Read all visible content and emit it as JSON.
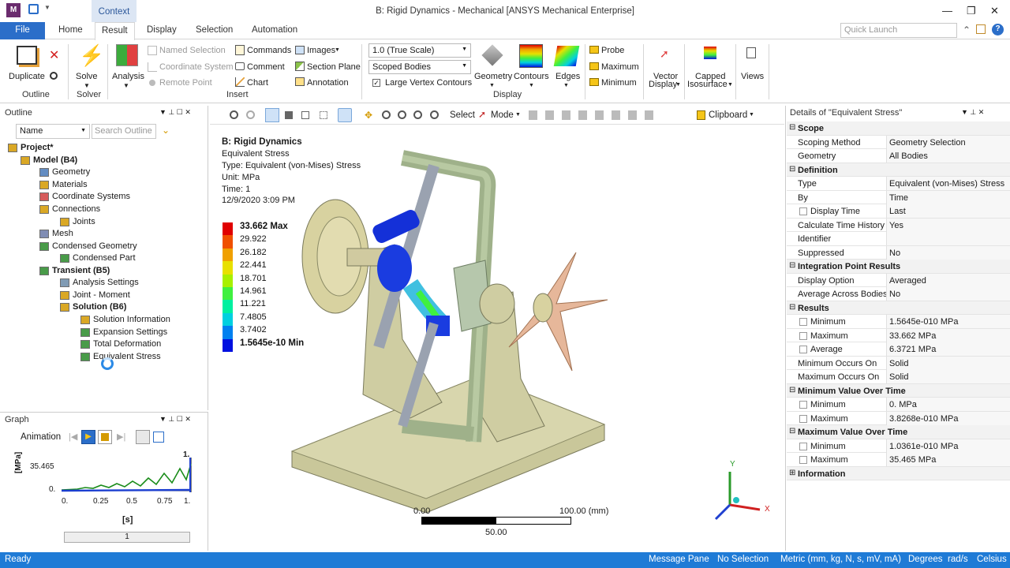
{
  "window": {
    "title": "B: Rigid Dynamics - Mechanical [ANSYS Mechanical Enterprise]",
    "context_tab": "Context"
  },
  "tabs": {
    "file": "File",
    "items": [
      "Home",
      "Result",
      "Display",
      "Selection",
      "Automation"
    ],
    "active": "Result"
  },
  "quick_launch": {
    "placeholder": "Quick Launch"
  },
  "ribbon": {
    "outline": {
      "duplicate": "Duplicate",
      "group": "Outline"
    },
    "solve": {
      "solve": "Solve",
      "group": "Solver"
    },
    "insert": {
      "analysis": "Analysis",
      "named_selection": "Named Selection",
      "coordinate_system": "Coordinate System",
      "remote_point": "Remote Point",
      "commands": "Commands",
      "comment": "Comment",
      "chart": "Chart",
      "images": "Images",
      "section_plane": "Section Plane",
      "annotation": "Annotation",
      "group": "Insert"
    },
    "display": {
      "scale": "1.0 (True Scale)",
      "bodies": "Scoped Bodies",
      "large_vertex": "Large Vertex Contours",
      "geometry": "Geometry",
      "contours": "Contours",
      "edges": "Edges",
      "group": "Display"
    },
    "probe": {
      "probe": "Probe",
      "maximum": "Maximum",
      "minimum": "Minimum"
    },
    "vector": {
      "line1": "Vector",
      "line2": "Display"
    },
    "capped": {
      "line1": "Capped",
      "line2": "Isosurface"
    },
    "views": "Views"
  },
  "outline": {
    "title": "Outline",
    "filter": "Name",
    "search_placeholder": "Search Outline",
    "tree": {
      "project": "Project*",
      "model": "Model (B4)",
      "geometry": "Geometry",
      "materials": "Materials",
      "coord": "Coordinate Systems",
      "connections": "Connections",
      "joints": "Joints",
      "mesh": "Mesh",
      "condensed": "Condensed Geometry",
      "condensed_part": "Condensed Part",
      "transient": "Transient (B5)",
      "analysis_settings": "Analysis Settings",
      "joint_moment": "Joint - Moment",
      "solution": "Solution (B6)",
      "solution_info": "Solution Information",
      "expansion": "Expansion Settings",
      "total_def": "Total Deformation",
      "eq_stress": "Equivalent Stress"
    }
  },
  "graph": {
    "title": "Graph",
    "animation": "Animation",
    "ymax": "35.465",
    "ymin": "0.",
    "ylabel": "[MPa]",
    "xlabel": "[s]",
    "xticks": [
      "0.",
      "0.25",
      "0.5",
      "0.75",
      "1."
    ],
    "corner": "1.",
    "frame": "1"
  },
  "toolbar": {
    "select": "Select",
    "mode": "Mode",
    "clipboard": "Clipboard"
  },
  "viewport": {
    "header": {
      "title": "B: Rigid Dynamics",
      "result": "Equivalent Stress",
      "type": "Type: Equivalent (von-Mises) Stress",
      "unit": "Unit: MPa",
      "time": "Time: 1",
      "date": "12/9/2020 3:09 PM"
    },
    "legend": [
      "33.662 Max",
      "29.922",
      "26.182",
      "22.441",
      "18.701",
      "14.961",
      "11.221",
      "7.4805",
      "3.7402",
      "1.5645e-10 Min"
    ],
    "legend_colors": [
      "#e00000",
      "#f05000",
      "#f0a000",
      "#e8e000",
      "#a8f000",
      "#40f040",
      "#00f0a0",
      "#00d0e0",
      "#0080f0",
      "#0010e0"
    ],
    "scale": {
      "left": "0.00",
      "right": "100.00 (mm)",
      "mid": "50.00"
    },
    "axes": {
      "y": "Y",
      "x": "X"
    }
  },
  "details": {
    "title": "Details of \"Equivalent Stress\"",
    "rows": [
      {
        "s": "Scope"
      },
      {
        "k": "Scoping Method",
        "v": "Geometry Selection"
      },
      {
        "k": "Geometry",
        "v": "All Bodies"
      },
      {
        "s": "Definition"
      },
      {
        "k": "Type",
        "v": "Equivalent (von-Mises) Stress"
      },
      {
        "k": "By",
        "v": "Time"
      },
      {
        "k": "Display Time",
        "v": "Last",
        "c": true
      },
      {
        "k": "Calculate Time History",
        "v": "Yes"
      },
      {
        "k": "Identifier",
        "v": ""
      },
      {
        "k": "Suppressed",
        "v": "No"
      },
      {
        "s": "Integration Point Results"
      },
      {
        "k": "Display Option",
        "v": "Averaged"
      },
      {
        "k": "Average Across Bodies",
        "v": "No"
      },
      {
        "s": "Results"
      },
      {
        "k": "Minimum",
        "v": "1.5645e-010 MPa",
        "c": true
      },
      {
        "k": "Maximum",
        "v": "33.662 MPa",
        "c": true
      },
      {
        "k": "Average",
        "v": "6.3721 MPa",
        "c": true
      },
      {
        "k": "Minimum Occurs On",
        "v": "Solid"
      },
      {
        "k": "Maximum Occurs On",
        "v": "Solid"
      },
      {
        "s": "Minimum Value Over Time"
      },
      {
        "k": "Minimum",
        "v": "0. MPa",
        "c": true
      },
      {
        "k": "Maximum",
        "v": "3.8268e-010 MPa",
        "c": true
      },
      {
        "s": "Maximum Value Over Time"
      },
      {
        "k": "Minimum",
        "v": "1.0361e-010 MPa",
        "c": true
      },
      {
        "k": "Maximum",
        "v": "35.465 MPa",
        "c": true
      },
      {
        "s": "Information",
        "plus": true
      }
    ]
  },
  "status": {
    "ready": "Ready",
    "message": "Message Pane",
    "selection": "No Selection",
    "units": "Metric (mm, kg, N, s, mV, mA)",
    "angle": "Degrees",
    "rate": "rad/s",
    "temp": "Celsius"
  }
}
